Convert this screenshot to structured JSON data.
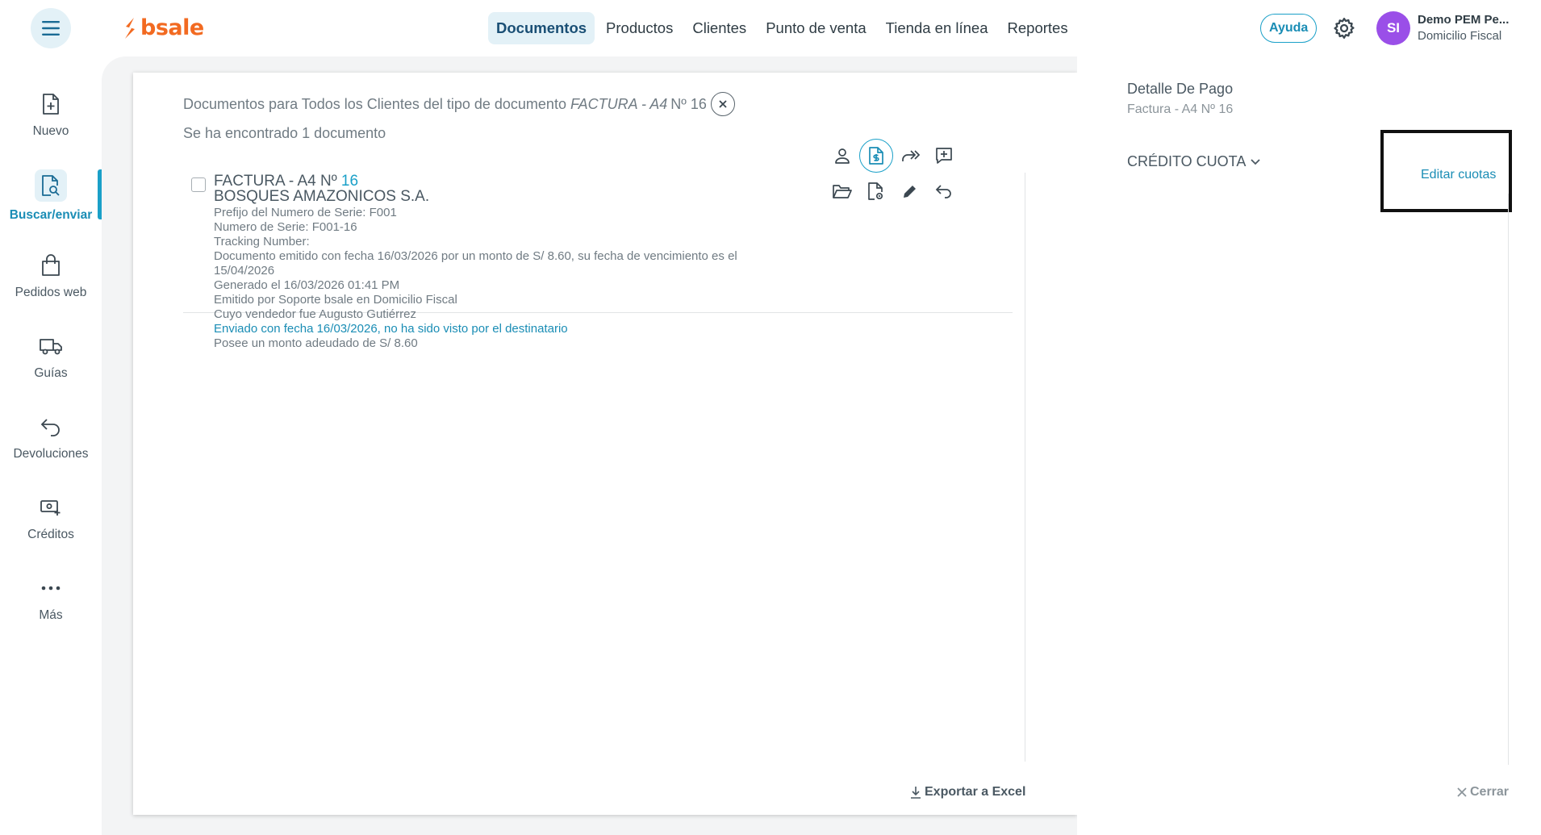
{
  "header": {
    "logo_text": "bsale",
    "nav": [
      {
        "label": "Documentos",
        "active": true
      },
      {
        "label": "Productos",
        "active": false
      },
      {
        "label": "Clientes",
        "active": false
      },
      {
        "label": "Punto de venta",
        "active": false
      },
      {
        "label": "Tienda en línea",
        "active": false
      },
      {
        "label": "Reportes",
        "active": false
      }
    ],
    "help_label": "Ayuda",
    "user": {
      "initials": "SI",
      "name": "Demo PEM Pe...",
      "branch": "Domicilio Fiscal"
    },
    "accent_color": "#1aa0c8",
    "brand_color": "#f26a21"
  },
  "sidebar": {
    "items": [
      {
        "label": "Nuevo",
        "icon": "file-plus-icon"
      },
      {
        "label": "Buscar/enviar",
        "icon": "file-search-icon",
        "active": true
      },
      {
        "label": "Pedidos web",
        "icon": "shopping-bag-icon"
      },
      {
        "label": "Guías",
        "icon": "truck-icon"
      },
      {
        "label": "Devoluciones",
        "icon": "return-arrow-icon"
      },
      {
        "label": "Créditos",
        "icon": "money-plus-icon"
      },
      {
        "label": "Más",
        "icon": "more-dots-icon"
      }
    ]
  },
  "search": {
    "title_prefix": "Documentos para Todos los Clientes del tipo de documento",
    "title_doc_type": "FACTURA - A4",
    "title_doc_number": "Nº 16",
    "found_text": "Se ha encontrado 1 documento"
  },
  "document": {
    "type_label": "FACTURA - A4 Nº",
    "number": "16",
    "client": "BOSQUES AMAZONICOS S.A.",
    "lines": [
      "Prefijo del Numero de Serie: F001",
      "Numero de Serie: F001-16",
      "Tracking Number:",
      "Documento emitido con fecha 16/03/2026 por un monto de S/ 8.60, su fecha de vencimiento es el 15/04/2026",
      "Generado el 16/03/2026 01:41 PM",
      "Emitido por Soporte bsale en Domicilio Fiscal",
      "Cuyo vendedor fue Augusto Gutiérrez"
    ],
    "sent_status": "Enviado con fecha 16/03/2026, no ha sido visto por el destinatario",
    "debt_text": "Posee un monto adeudado de S/ 8.60"
  },
  "footer": {
    "export_label": "Exportar a Excel",
    "close_label": "Cerrar"
  },
  "payment": {
    "title": "Detalle De Pago",
    "subtitle": "Factura - A4 Nº 16",
    "credit_label": "CRÉDITO CUOTA",
    "edit_label": "Editar cuotas"
  }
}
